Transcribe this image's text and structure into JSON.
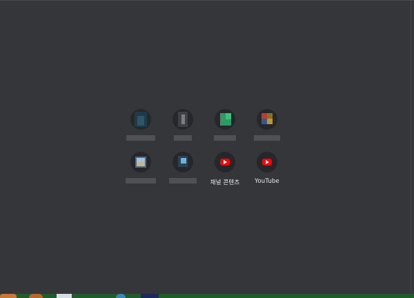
{
  "shortcuts": [
    {
      "label": "",
      "icon": "blurred-site-icon"
    },
    {
      "label": "",
      "icon": "blurred-site-icon"
    },
    {
      "label": "",
      "icon": "blurred-site-icon"
    },
    {
      "label": "",
      "icon": "blurred-site-icon"
    },
    {
      "label": "",
      "icon": "blurred-site-icon"
    },
    {
      "label": "",
      "icon": "blurred-site-icon"
    },
    {
      "label": "채널 콘텐츠",
      "icon": "youtube-icon"
    },
    {
      "label": "YouTube",
      "icon": "youtube-icon"
    }
  ],
  "colors": {
    "background": "#35363a",
    "icon_circle": "#26272a",
    "youtube_red": "#ff0000",
    "taskbar": "#1f5c2a"
  }
}
